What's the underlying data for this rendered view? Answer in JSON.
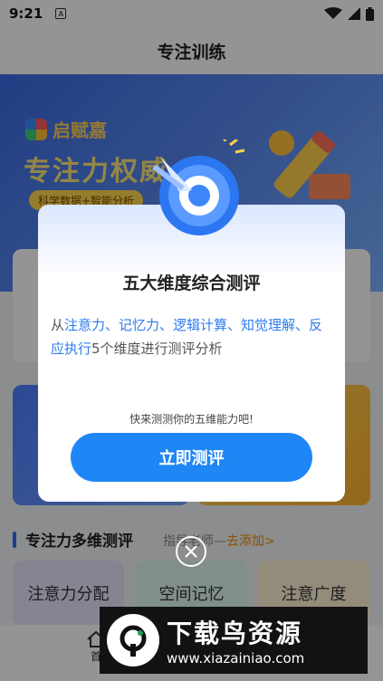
{
  "status_bar": {
    "time": "9:21",
    "notification_letter": "A"
  },
  "header": {
    "title": "专注训练"
  },
  "banner": {
    "brand": "启赋嘉",
    "headline": "专注力权威",
    "tagline": "科学数据+智能分析"
  },
  "section": {
    "title": "专注力多维测评",
    "subtitle_prefix": "指导老师—",
    "subtitle_link": "去添加>"
  },
  "chips": [
    "注意力分配",
    "空间记忆",
    "注意广度"
  ],
  "bottom_nav": {
    "home_label": "首"
  },
  "modal": {
    "title": "五大维度综合测评",
    "desc_prefix": "从",
    "desc_highlight_1": "注意力、记忆力、逻辑计算、知觉理解、",
    "desc_highlight_2": "反应执行",
    "desc_suffix": "5个维度进行测评分析",
    "hint": "快来测测你的五维能力吧!",
    "button": "立即测评"
  },
  "watermark": {
    "title": "下载鸟资源",
    "url": "www.xiazainiao.com"
  },
  "colors": {
    "primary": "#1f86f5",
    "highlight": "#2f7bf0",
    "link": "#f08a00"
  }
}
